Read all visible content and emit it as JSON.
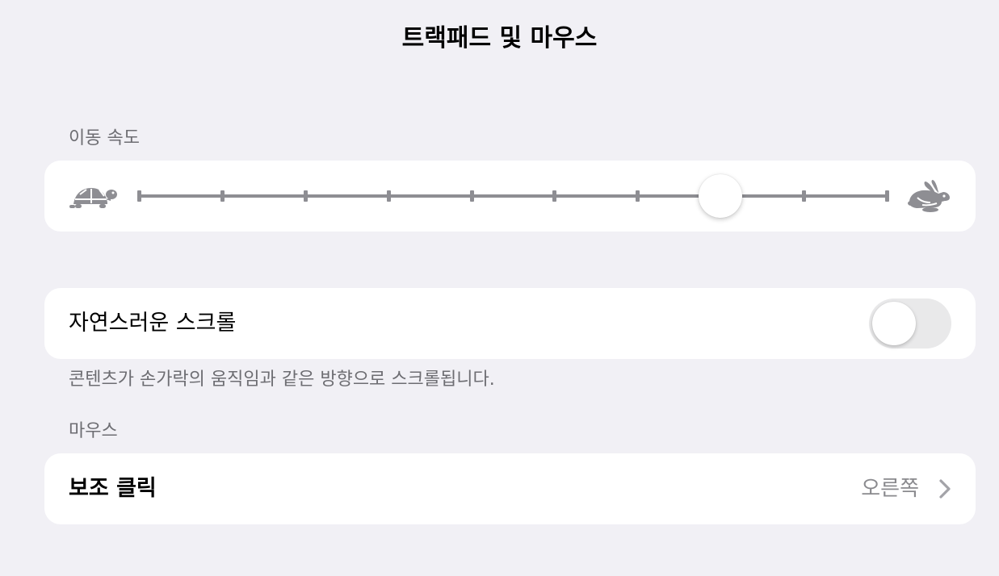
{
  "header": {
    "title": "트랙패드 및 마우스"
  },
  "tracking_speed": {
    "section_title": "이동 속도",
    "slow_icon": "turtle-icon",
    "fast_icon": "rabbit-icon",
    "slider_steps": 10,
    "slider_value_index": 7
  },
  "natural_scrolling": {
    "label": "자연스러운 스크롤",
    "enabled": false,
    "footer": "콘텐츠가 손가락의 움직임과 같은 방향으로 스크롤됩니다."
  },
  "mouse": {
    "section_title": "마우스",
    "secondary_click_label": "보조 클릭",
    "secondary_click_value": "오른쪽",
    "chevron_icon": "chevron-right-icon"
  },
  "colors": {
    "background": "#f1f0f5",
    "card": "#ffffff",
    "secondary_text": "#6d6d72",
    "slider": "#8e8e93",
    "toggle_off": "#e9e9ea"
  }
}
